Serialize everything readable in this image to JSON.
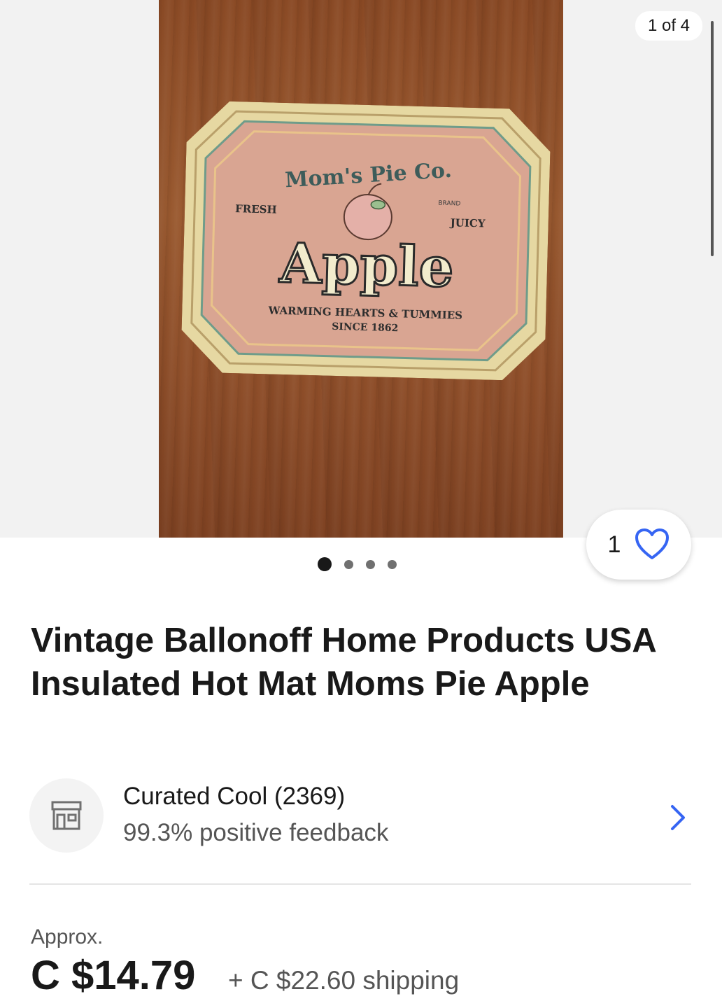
{
  "gallery": {
    "counter": "1 of 4",
    "dots_total": 4,
    "active_index": 0,
    "watch_count": "1",
    "photo": {
      "brand": "Mom's Pie Co.",
      "left_tag": "FRESH",
      "right_tag": "JUICY",
      "tiny": "BRAND",
      "word": "Apple",
      "tagline_1": "WARMING HEARTS & TUMMIES",
      "tagline_2": "SINCE 1862"
    }
  },
  "listing": {
    "title": "Vintage Ballonoff Home Products USA Insulated Hot Mat Moms Pie Apple"
  },
  "seller": {
    "name": "Curated Cool (2369)",
    "feedback": "99.3% positive feedback",
    "icon": "store-icon"
  },
  "pricing": {
    "approx_label": "Approx.",
    "price": "C $14.79",
    "shipping": "+ C $22.60 shipping"
  },
  "colors": {
    "accent": "#3665f3",
    "text": "#191919",
    "muted": "#555555"
  }
}
